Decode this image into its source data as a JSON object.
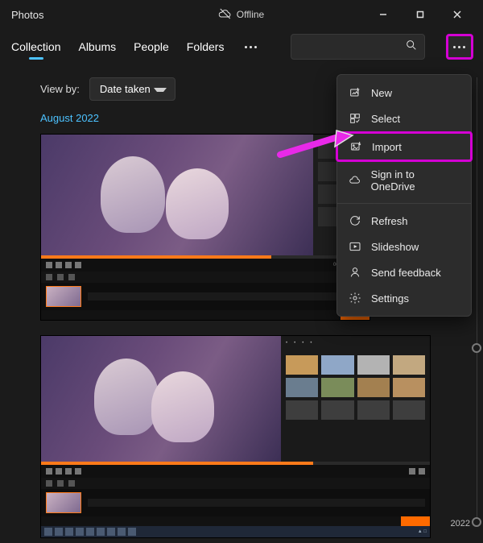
{
  "titlebar": {
    "app_name": "Photos",
    "status": "Offline"
  },
  "tabs": {
    "items": [
      "Collection",
      "Albums",
      "People",
      "Folders"
    ],
    "active_index": 0
  },
  "viewby": {
    "label": "View by:",
    "selected": "Date taken"
  },
  "month_header": "August 2022",
  "menu": {
    "new": "New",
    "select": "Select",
    "import": "Import",
    "onedrive": "Sign in to OneDrive",
    "refresh": "Refresh",
    "slideshow": "Slideshow",
    "feedback": "Send feedback",
    "settings": "Settings"
  },
  "rail_year": "2022"
}
